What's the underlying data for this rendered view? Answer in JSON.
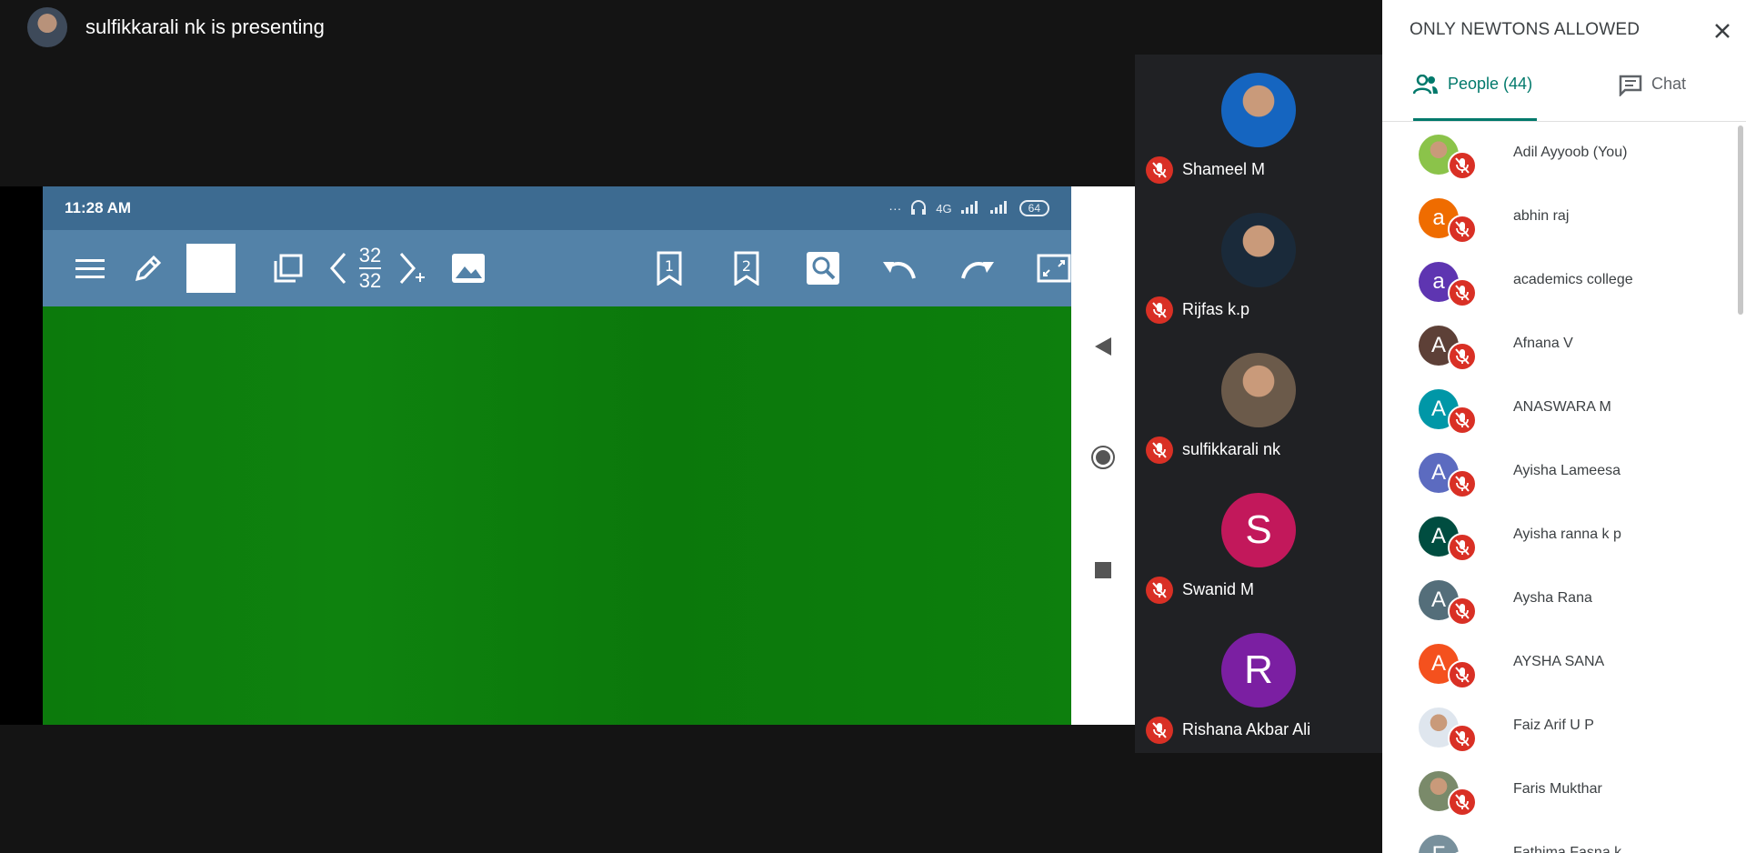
{
  "presenting": {
    "text": "sulfikkarali nk is presenting"
  },
  "shared_screen": {
    "status_time": "11:28 AM",
    "status_network": "4G",
    "status_battery": "64",
    "page_current": "32",
    "page_total": "32"
  },
  "tiles": [
    {
      "name": "Shameel M",
      "initial": "",
      "color": "#1565c0",
      "photo": true
    },
    {
      "name": "Rijfas k.p",
      "initial": "",
      "color": "#1a2a3a",
      "photo": true
    },
    {
      "name": "sulfikkarali nk",
      "initial": "",
      "color": "#6b5a4a",
      "photo": true
    },
    {
      "name": "Swanid M",
      "initial": "S",
      "color": "#c2185b",
      "photo": false
    },
    {
      "name": "Rishana Akbar Ali",
      "initial": "R",
      "color": "#7b1fa2",
      "photo": false
    }
  ],
  "panel": {
    "title": "ONLY NEWTONS ALLOWED",
    "tab_people": "People (44)",
    "tab_chat": "Chat",
    "people": [
      {
        "name": "Adil Ayyoob (You)",
        "initial": "",
        "color": "#8bc34a",
        "photo": true
      },
      {
        "name": "abhin raj",
        "initial": "a",
        "color": "#ef6c00",
        "photo": false
      },
      {
        "name": "academics college",
        "initial": "a",
        "color": "#5e35b1",
        "photo": false
      },
      {
        "name": "Afnana V",
        "initial": "A",
        "color": "#5d4037",
        "photo": false
      },
      {
        "name": "ANASWARA M",
        "initial": "A",
        "color": "#0097a7",
        "photo": false
      },
      {
        "name": "Ayisha Lameesa",
        "initial": "A",
        "color": "#5c6bc0",
        "photo": false
      },
      {
        "name": "Ayisha ranna k p",
        "initial": "A",
        "color": "#004d40",
        "photo": false
      },
      {
        "name": "Aysha Rana",
        "initial": "A",
        "color": "#546e7a",
        "photo": false
      },
      {
        "name": "AYSHA SANA",
        "initial": "A",
        "color": "#f4511e",
        "photo": false
      },
      {
        "name": "Faiz Arif U P",
        "initial": "",
        "color": "#dfe6ee",
        "photo": true
      },
      {
        "name": "Faris Mukthar",
        "initial": "",
        "color": "#7a8a6a",
        "photo": true
      },
      {
        "name": "Fathima Fasna k",
        "initial": "F",
        "color": "#78909c",
        "photo": false
      }
    ]
  },
  "colors": {
    "accent": "#00796b",
    "mute": "#d93025",
    "phone_status": "#3d6b91",
    "phone_toolbar": "#5382a8",
    "board": "#0d7d0d"
  }
}
